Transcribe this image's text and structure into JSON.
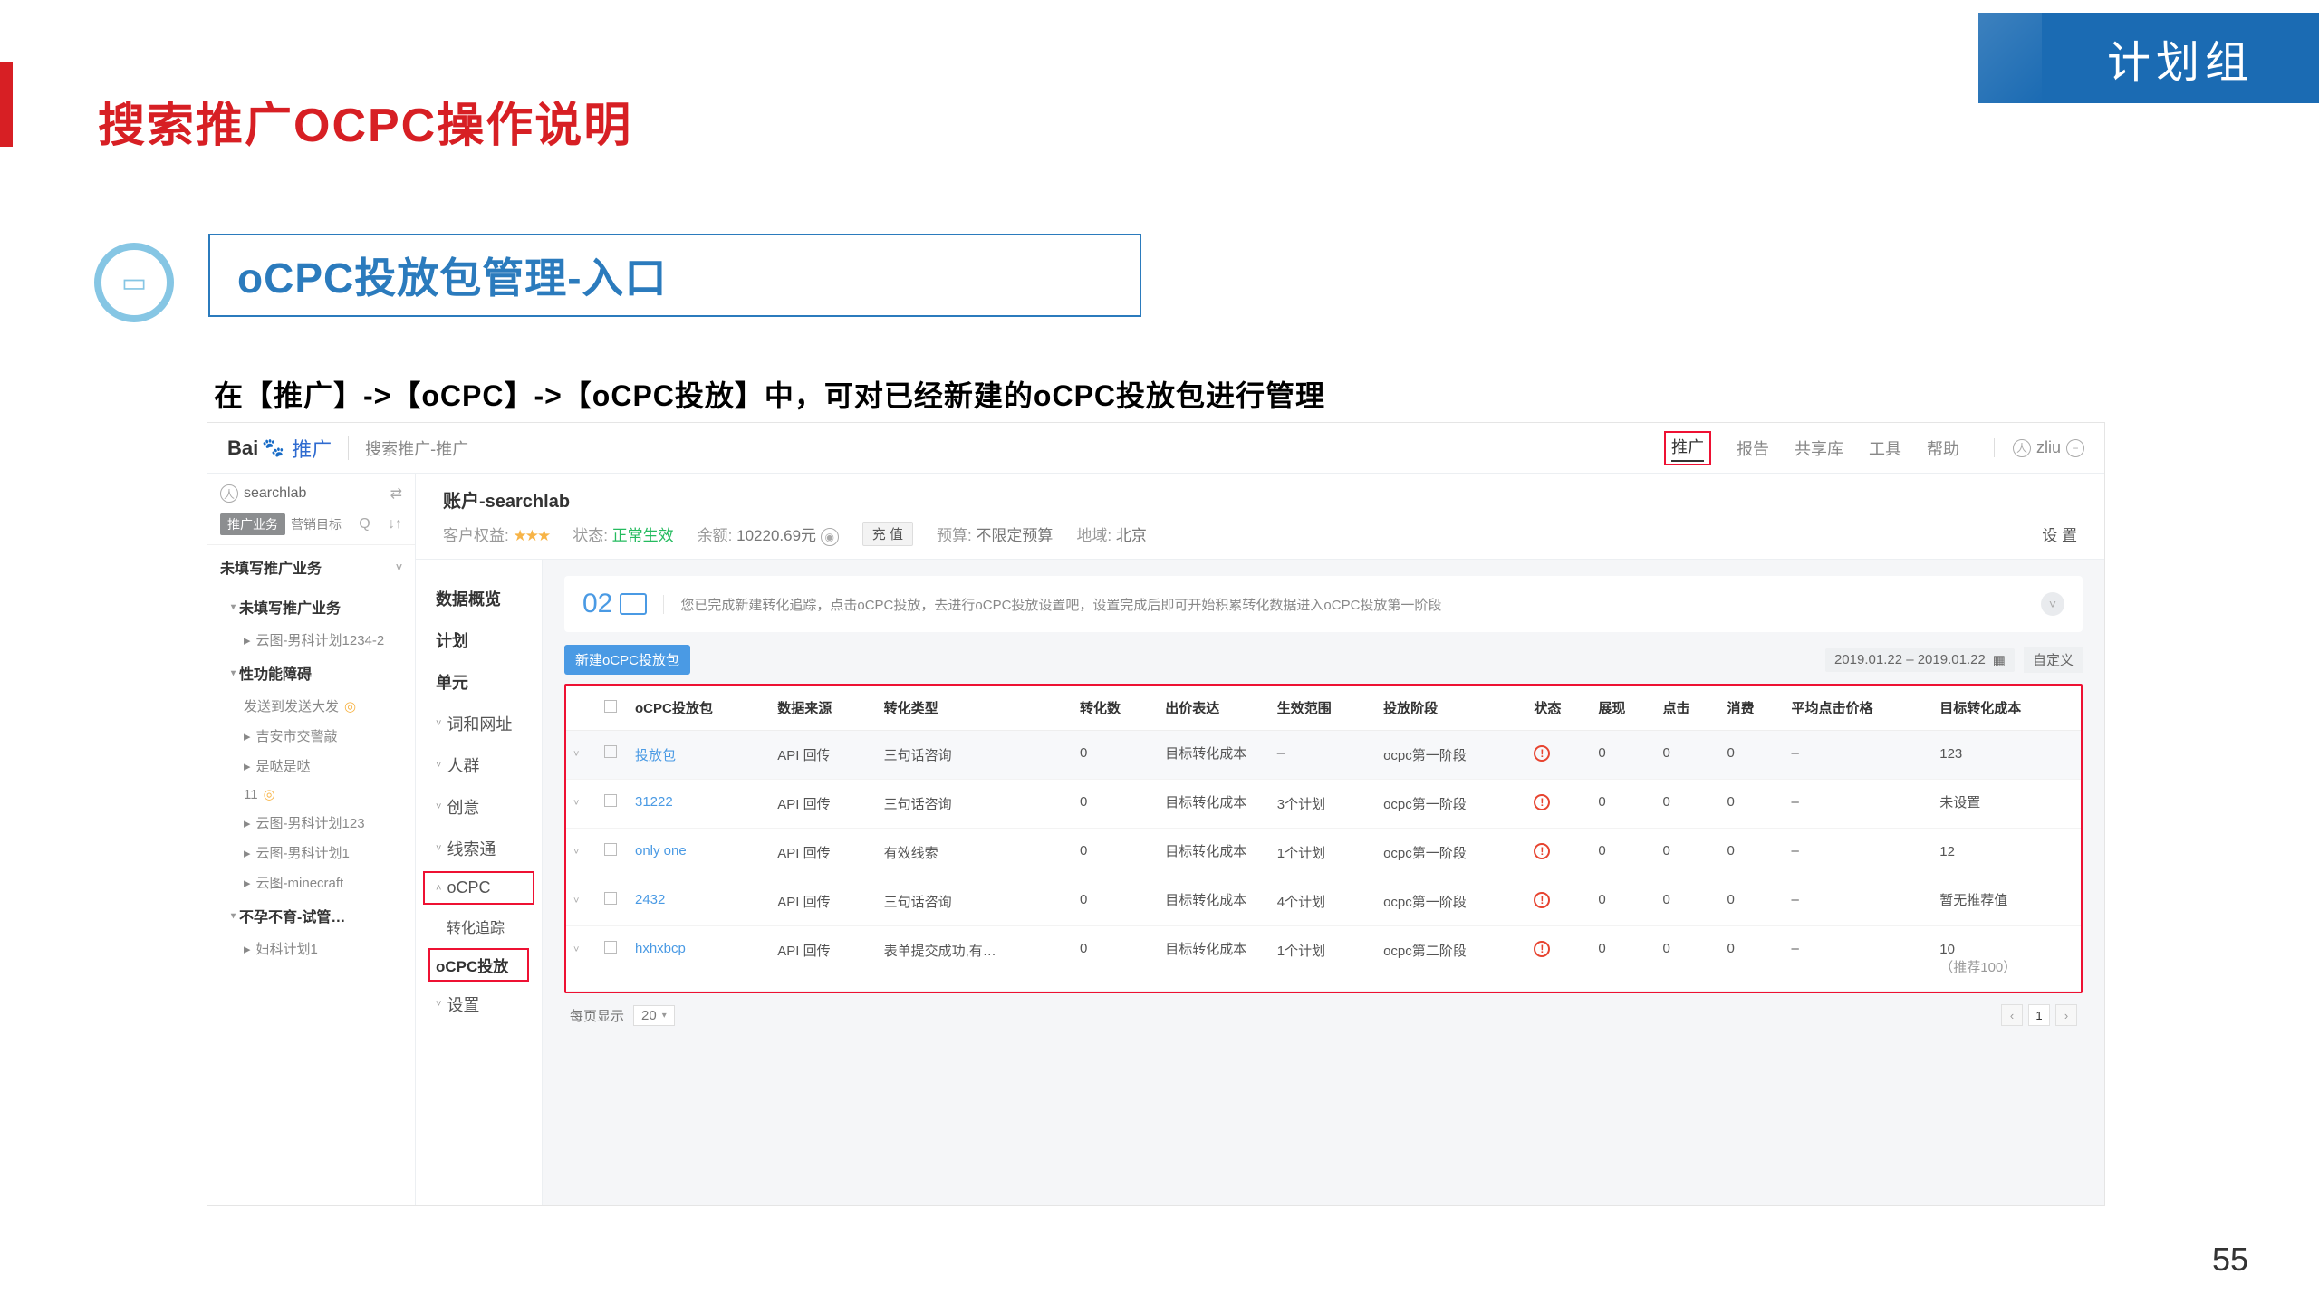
{
  "page_title": "搜索推广OCPC操作说明",
  "badge": "计划组",
  "section_title": "oCPC投放包管理-入口",
  "description": "在【推广】->【oCPC】->【oCPC投放】中，可对已经新建的oCPC投放包进行管理",
  "page_number": "55",
  "top": {
    "logo_bai": "Bai",
    "logo_du": "推广",
    "crumb": "搜索推广-推广",
    "nav": {
      "promo": "推广",
      "report": "报告",
      "share": "共享库",
      "tools": "工具",
      "help": "帮助"
    },
    "user": "zliu"
  },
  "left": {
    "account": "searchlab",
    "tabs": {
      "on": "推广业务",
      "off": "营销目标"
    },
    "cat1": "未填写推广业务",
    "grp1": "未填写推广业务",
    "grp1_items": [
      "云图-男科计划1234-2"
    ],
    "grp2": "性功能障碍",
    "grp2_items": [
      "发送到发送大发",
      "吉安市交警敲",
      "是哒是哒",
      "11",
      "云图-男科计划123",
      "云图-男科计划1",
      "云图-minecraft"
    ],
    "grp3": "不孕不育-试管…",
    "grp3_items": [
      "妇科计划1"
    ]
  },
  "acct": {
    "title": "账户-searchlab",
    "rights_lbl": "客户权益:",
    "status_lbl": "状态:",
    "status_val": "正常生效",
    "balance_lbl": "余额:",
    "balance_val": "10220.69元",
    "recharge": "充 值",
    "budget_lbl": "预算:",
    "budget_val": "不限定预算",
    "region_lbl": "地域:",
    "region_val": "北京",
    "settings": "设 置"
  },
  "midnav": {
    "overview": "数据概览",
    "plan": "计划",
    "unit": "单元",
    "keyword": "词和网址",
    "crowd": "人群",
    "creative": "创意",
    "lead": "线索通",
    "ocpc": "oCPC",
    "track": "转化追踪",
    "ocpc_deliver": "oCPC投放",
    "settings": "设置"
  },
  "alert": {
    "step": "02",
    "text": "您已完成新建转化追踪，点击oCPC投放，去进行oCPC投放设置吧，设置完成后即可开始积累转化数据进入oCPC投放第一阶段"
  },
  "toolbar": {
    "new_btn": "新建oCPC投放包",
    "date": "2019.01.22 – 2019.01.22",
    "custom": "自定义"
  },
  "table": {
    "headers": {
      "pkg": "oCPC投放包",
      "src": "数据来源",
      "type": "转化类型",
      "conv": "转化数",
      "bid": "出价表达",
      "scope": "生效范围",
      "stage": "投放阶段",
      "status": "状态",
      "imp": "展现",
      "clk": "点击",
      "cost": "消费",
      "cpc": "平均点击价格",
      "tcost": "目标转化成本"
    },
    "rows": [
      {
        "name": "投放包",
        "src": "API 回传",
        "type": "三句话咨询",
        "conv": "0",
        "bid": "目标转化成本",
        "scope": "–",
        "stage": "ocpc第一阶段",
        "imp": "0",
        "clk": "0",
        "cost": "0",
        "cpc": "–",
        "tcost": "123"
      },
      {
        "name": "31222",
        "src": "API 回传",
        "type": "三句话咨询",
        "conv": "0",
        "bid": "目标转化成本",
        "scope": "3个计划",
        "stage": "ocpc第一阶段",
        "imp": "0",
        "clk": "0",
        "cost": "0",
        "cpc": "–",
        "tcost": "未设置"
      },
      {
        "name": "only one",
        "src": "API 回传",
        "type": "有效线索",
        "conv": "0",
        "bid": "目标转化成本",
        "scope": "1个计划",
        "stage": "ocpc第一阶段",
        "imp": "0",
        "clk": "0",
        "cost": "0",
        "cpc": "–",
        "tcost": "12"
      },
      {
        "name": "2432",
        "src": "API 回传",
        "type": "三句话咨询",
        "conv": "0",
        "bid": "目标转化成本",
        "scope": "4个计划",
        "stage": "ocpc第一阶段",
        "imp": "0",
        "clk": "0",
        "cost": "0",
        "cpc": "–",
        "tcost": "暂无推荐值"
      },
      {
        "name": "hxhxbcp",
        "src": "API 回传",
        "type": "表单提交成功,有…",
        "conv": "0",
        "bid": "目标转化成本",
        "scope": "1个计划",
        "stage": "ocpc第二阶段",
        "imp": "0",
        "clk": "0",
        "cost": "0",
        "cpc": "–",
        "tcost": "10\n（推荐100）"
      }
    ]
  },
  "pager": {
    "label": "每页显示",
    "size": "20",
    "page": "1"
  }
}
